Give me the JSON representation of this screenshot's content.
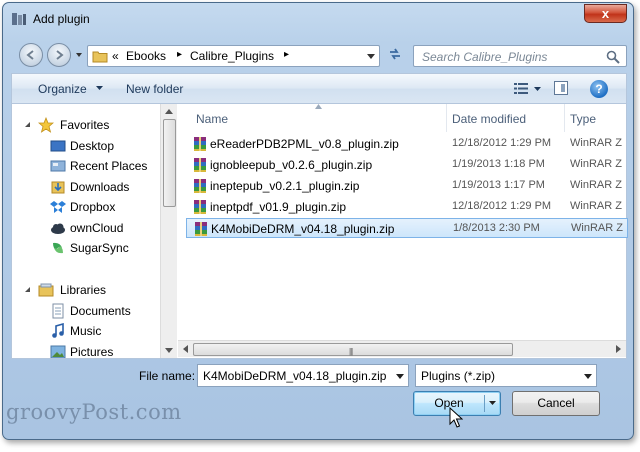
{
  "window": {
    "title": "Add plugin",
    "close_label": "x"
  },
  "navigation": {
    "breadcrumb_prefix": "«",
    "breadcrumbs": [
      "Ebooks",
      "Calibre_Plugins"
    ],
    "search_placeholder": "Search Calibre_Plugins"
  },
  "toolbar": {
    "organize_label": "Organize",
    "new_folder_label": "New folder",
    "help_label": "?"
  },
  "sidebar": {
    "favorites_label": "Favorites",
    "favorites": [
      "Desktop",
      "Recent Places",
      "Downloads",
      "Dropbox",
      "ownCloud",
      "SugarSync"
    ],
    "libraries_label": "Libraries",
    "libraries": [
      "Documents",
      "Music",
      "Pictures"
    ]
  },
  "file_list": {
    "columns": [
      "Name",
      "Date modified",
      "Type"
    ],
    "files": [
      {
        "name": "eReaderPDB2PML_v0.8_plugin.zip",
        "date": "12/18/2012 1:29 PM",
        "type": "WinRAR Z"
      },
      {
        "name": "ignobleepub_v0.2.6_plugin.zip",
        "date": "1/19/2013 1:18 PM",
        "type": "WinRAR Z"
      },
      {
        "name": "ineptepub_v0.2.1_plugin.zip",
        "date": "1/19/2013 1:17 PM",
        "type": "WinRAR Z"
      },
      {
        "name": "ineptpdf_v01.9_plugin.zip",
        "date": "12/18/2012 1:29 PM",
        "type": "WinRAR Z"
      },
      {
        "name": "K4MobiDeDRM_v04.18_plugin.zip",
        "date": "1/8/2013 2:30 PM",
        "type": "WinRAR Z"
      }
    ],
    "selected_index": 4
  },
  "footer": {
    "file_name_label": "File name:",
    "file_name_value": "K4MobiDeDRM_v04.18_plugin.zip",
    "file_type_value": "Plugins (*.zip)",
    "open_label": "Open",
    "cancel_label": "Cancel"
  },
  "watermark": "groovyPost.com",
  "colors": {
    "selection": "#cde6fb",
    "selection_border": "#7db3e8",
    "link_text": "#1e395b"
  }
}
